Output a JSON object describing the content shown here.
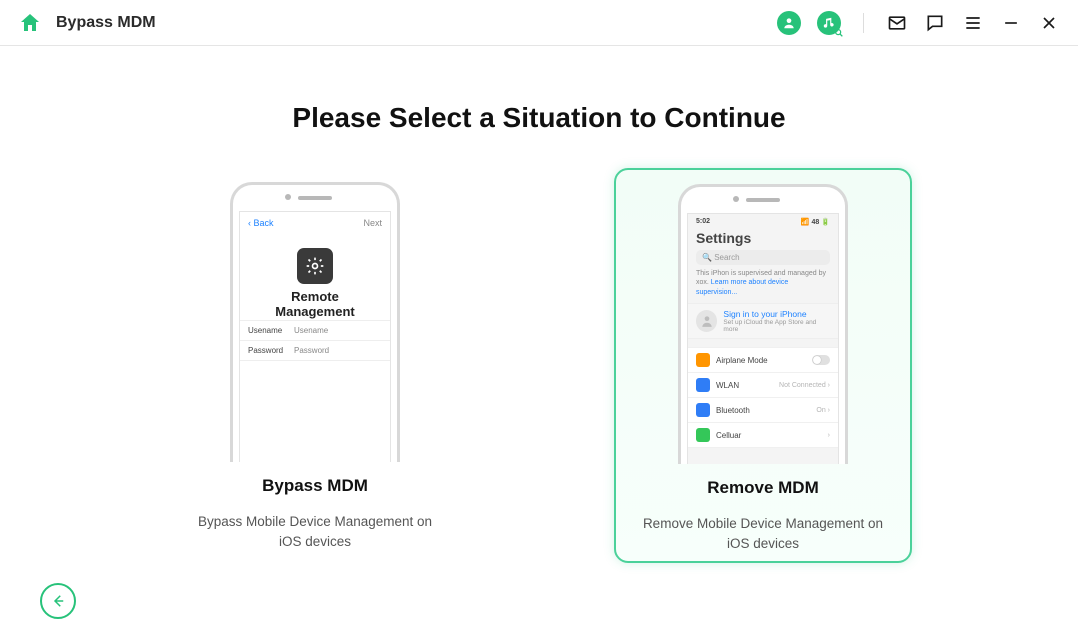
{
  "header": {
    "title": "Bypass MDM"
  },
  "page": {
    "title": "Please Select a Situation to Continue"
  },
  "cards": {
    "bypass": {
      "title": "Bypass MDM",
      "desc": "Bypass Mobile Device Management on iOS devices",
      "phone": {
        "back": "Back",
        "next": "Next",
        "heading_line1": "Remote",
        "heading_line2": "Management",
        "username_label": "Usename",
        "username_ph": "Usename",
        "password_label": "Password",
        "password_ph": "Password"
      }
    },
    "remove": {
      "title": "Remove MDM",
      "desc": "Remove Mobile Device Management on iOS devices",
      "phone": {
        "time": "5:02",
        "signal": "48",
        "heading": "Settings",
        "search_ph": "Search",
        "supervised_text": "This iPhon is supervised and managed by xox.",
        "supervised_link": "Learn more about device supervision...",
        "signin": "Sign in to your iPhone",
        "signin_sub": "Set up iCloud the App Store and more",
        "rows": {
          "airplane": "Airplane Mode",
          "wlan": "WLAN",
          "wlan_val": "Not Connected",
          "bt": "Bluetooth",
          "bt_val": "On",
          "cell": "Celluar"
        }
      }
    }
  }
}
